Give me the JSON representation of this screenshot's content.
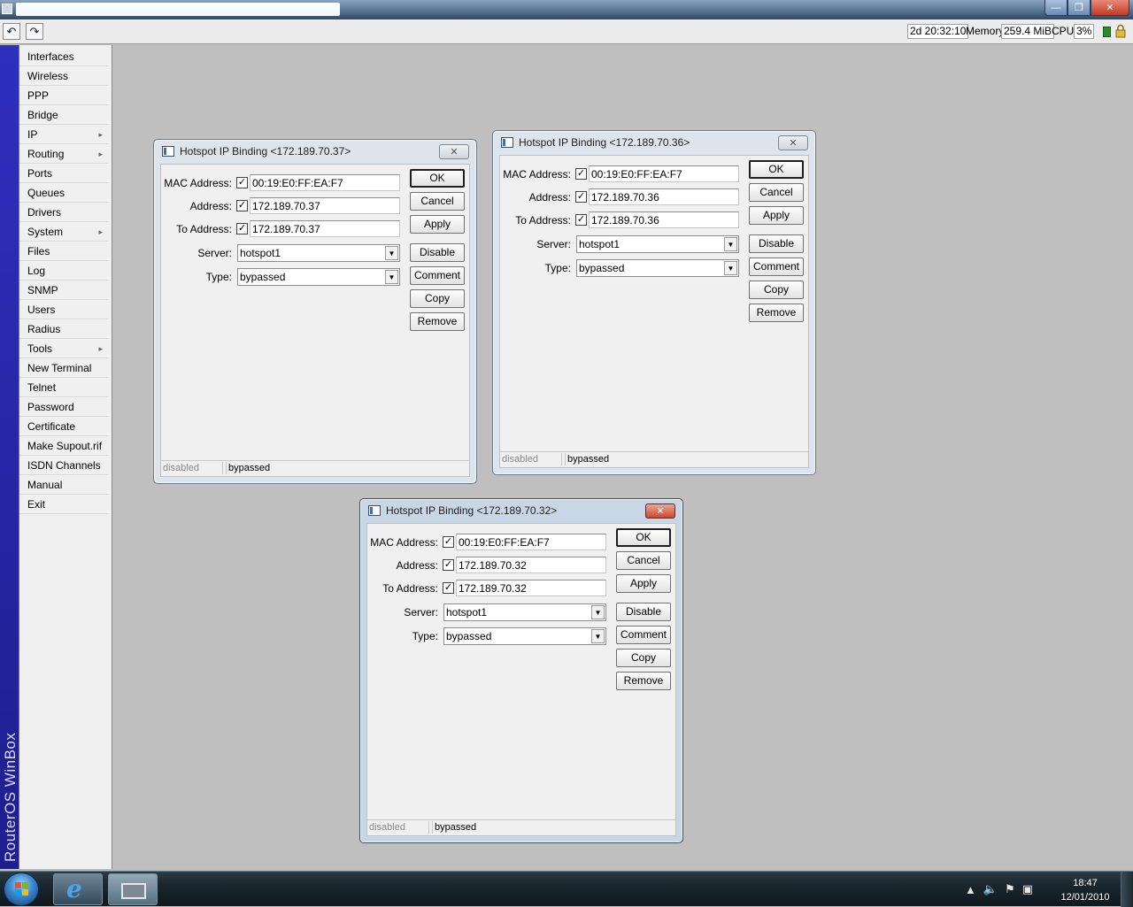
{
  "toolbar": {
    "uptime": "2d 20:32:10",
    "memory_label": "Memory:",
    "memory_value": "259.4 MiB",
    "cpu_label": "CPU:",
    "cpu_value": "3%"
  },
  "left_strip": {
    "brand": "RouterOS WinBox"
  },
  "sidebar": {
    "items": [
      {
        "label": "Interfaces",
        "submenu": false
      },
      {
        "label": "Wireless",
        "submenu": false
      },
      {
        "label": "PPP",
        "submenu": false
      },
      {
        "label": "Bridge",
        "submenu": false
      },
      {
        "label": "IP",
        "submenu": true
      },
      {
        "label": "Routing",
        "submenu": true
      },
      {
        "label": "Ports",
        "submenu": false
      },
      {
        "label": "Queues",
        "submenu": false
      },
      {
        "label": "Drivers",
        "submenu": false
      },
      {
        "label": "System",
        "submenu": true
      },
      {
        "label": "Files",
        "submenu": false
      },
      {
        "label": "Log",
        "submenu": false
      },
      {
        "label": "SNMP",
        "submenu": false
      },
      {
        "label": "Users",
        "submenu": false
      },
      {
        "label": "Radius",
        "submenu": false
      },
      {
        "label": "Tools",
        "submenu": true
      },
      {
        "label": "New Terminal",
        "submenu": false
      },
      {
        "label": "Telnet",
        "submenu": false
      },
      {
        "label": "Password",
        "submenu": false
      },
      {
        "label": "Certificate",
        "submenu": false
      },
      {
        "label": "Make Supout.rif",
        "submenu": false
      },
      {
        "label": "ISDN Channels",
        "submenu": false
      },
      {
        "label": "Manual",
        "submenu": false
      },
      {
        "label": "Exit",
        "submenu": false
      }
    ]
  },
  "dialogs": [
    {
      "title": "Hotspot IP Binding <172.189.70.37>",
      "active": false,
      "mac_label": "MAC Address:",
      "mac_value": "00:19:E0:FF:EA:F7",
      "address_label": "Address:",
      "address_value": "172.189.70.37",
      "to_address_label": "To Address:",
      "to_address_value": "172.189.70.37",
      "server_label": "Server:",
      "server_value": "hotspot1",
      "type_label": "Type:",
      "type_value": "bypassed",
      "status_left": "disabled",
      "status_right": "bypassed"
    },
    {
      "title": "Hotspot IP Binding <172.189.70.36>",
      "active": false,
      "mac_label": "MAC Address:",
      "mac_value": "00:19:E0:FF:EA:F7",
      "address_label": "Address:",
      "address_value": "172.189.70.36",
      "to_address_label": "To Address:",
      "to_address_value": "172.189.70.36",
      "server_label": "Server:",
      "server_value": "hotspot1",
      "type_label": "Type:",
      "type_value": "bypassed",
      "status_left": "disabled",
      "status_right": "bypassed"
    },
    {
      "title": "Hotspot IP Binding <172.189.70.32>",
      "active": true,
      "mac_label": "MAC Address:",
      "mac_value": "00:19:E0:FF:EA:F7",
      "address_label": "Address:",
      "address_value": "172.189.70.32",
      "to_address_label": "To Address:",
      "to_address_value": "172.189.70.32",
      "server_label": "Server:",
      "server_value": "hotspot1",
      "type_label": "Type:",
      "type_value": "bypassed",
      "status_left": "disabled",
      "status_right": "bypassed"
    }
  ],
  "buttons": {
    "ok": "OK",
    "cancel": "Cancel",
    "apply": "Apply",
    "disable": "Disable",
    "comment": "Comment",
    "copy": "Copy",
    "remove": "Remove"
  },
  "taskbar": {
    "time": "18:47",
    "date": "12/01/2010"
  },
  "colors": {
    "workspace": "#bfbfbf",
    "left_strip": "#2a2ab0",
    "brand_text": "#d7d7ff"
  },
  "icons": {
    "undo": "undo-icon",
    "redo": "redo-icon",
    "lock": "lock-icon",
    "start": "windows-start-icon",
    "ie": "internet-explorer-icon"
  }
}
